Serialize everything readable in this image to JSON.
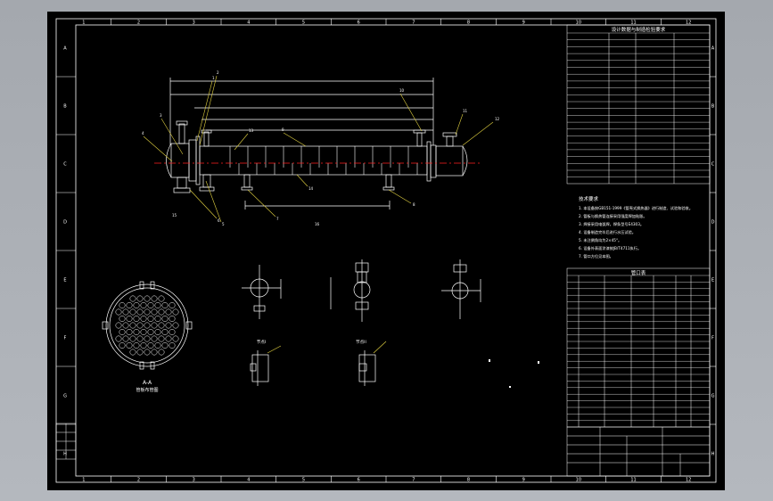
{
  "colors": {
    "background": "#000000",
    "frame": "#ffffff",
    "centerline": "#ff2020",
    "dimension": "#ffffff",
    "leader": "#e0d040",
    "viewport": "#a9adb3"
  },
  "grid": {
    "columns": [
      "1",
      "2",
      "3",
      "4",
      "5",
      "6",
      "7",
      "8",
      "9",
      "10",
      "11",
      "12"
    ],
    "rows": [
      "A",
      "B",
      "C",
      "D",
      "E",
      "F",
      "G",
      "H"
    ]
  },
  "tables": {
    "spec_title": "设计数据与制造检验要求",
    "notes_title": "技术要求",
    "parts_title": "管口表",
    "notes": [
      "1. 本设备按GB151-1999《管壳式换热器》进行制造、试验和验收。",
      "2. 管板与换热管连接采用强度焊加贴胀。",
      "3. 焊接采用电弧焊，焊条型号E4303。",
      "4. 设备制造完毕后进行水压试验。",
      "5. 未注倒角均为2×45°。",
      "6. 设备外表面涂漆按JB/T4711执行。",
      "7. 管口方位见本图。"
    ]
  },
  "views": {
    "section_label": "A-A",
    "section_sub": "管板布管图"
  },
  "callouts": [
    "1",
    "2",
    "3",
    "4",
    "5",
    "6",
    "7",
    "8",
    "9",
    "10",
    "11",
    "12",
    "13",
    "14",
    "15",
    "16"
  ],
  "detail_labels": [
    "节点I",
    "节点II"
  ]
}
